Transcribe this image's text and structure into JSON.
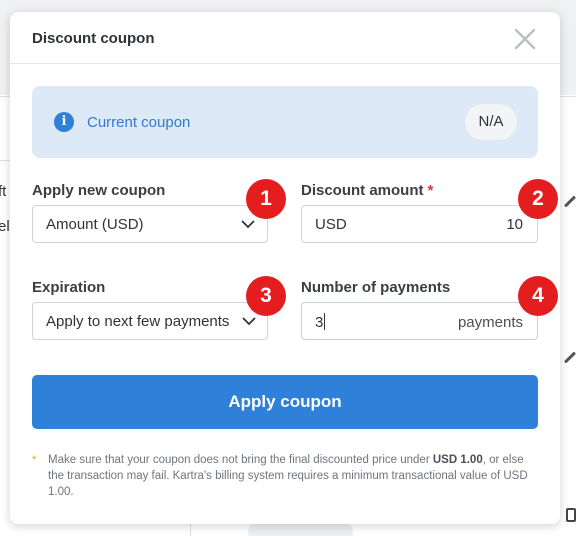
{
  "background": {
    "left_fragment_1": "ft",
    "left_fragment_2": "el"
  },
  "dialog": {
    "title": "Discount coupon",
    "close_icon": "close-icon"
  },
  "current_coupon": {
    "label": "Current coupon",
    "value": "N/A",
    "icon": "info-icon"
  },
  "apply_new_coupon": {
    "label": "Apply new coupon",
    "selected": "Amount (USD)"
  },
  "discount_amount": {
    "label": "Discount amount",
    "required_mark": "*",
    "currency": "USD",
    "value": "10"
  },
  "expiration": {
    "label": "Expiration",
    "selected": "Apply to next few payments"
  },
  "number_of_payments": {
    "label": "Number of payments",
    "value": "3",
    "suffix": "payments"
  },
  "markers": [
    "1",
    "2",
    "3",
    "4"
  ],
  "apply_button": {
    "label": "Apply coupon"
  },
  "footnote": {
    "star": "*",
    "part1": "Make sure that your coupon does not bring the final discounted price under ",
    "bold": "USD 1.00",
    "part2": ", or else the transaction may fail. Kartra's billing system requires a minimum transactional value of USD 1.00."
  },
  "colors": {
    "accent": "#2f80d8",
    "marker": "#e41e1e",
    "info_bg": "#dde9f7",
    "required": "#d9363e"
  }
}
